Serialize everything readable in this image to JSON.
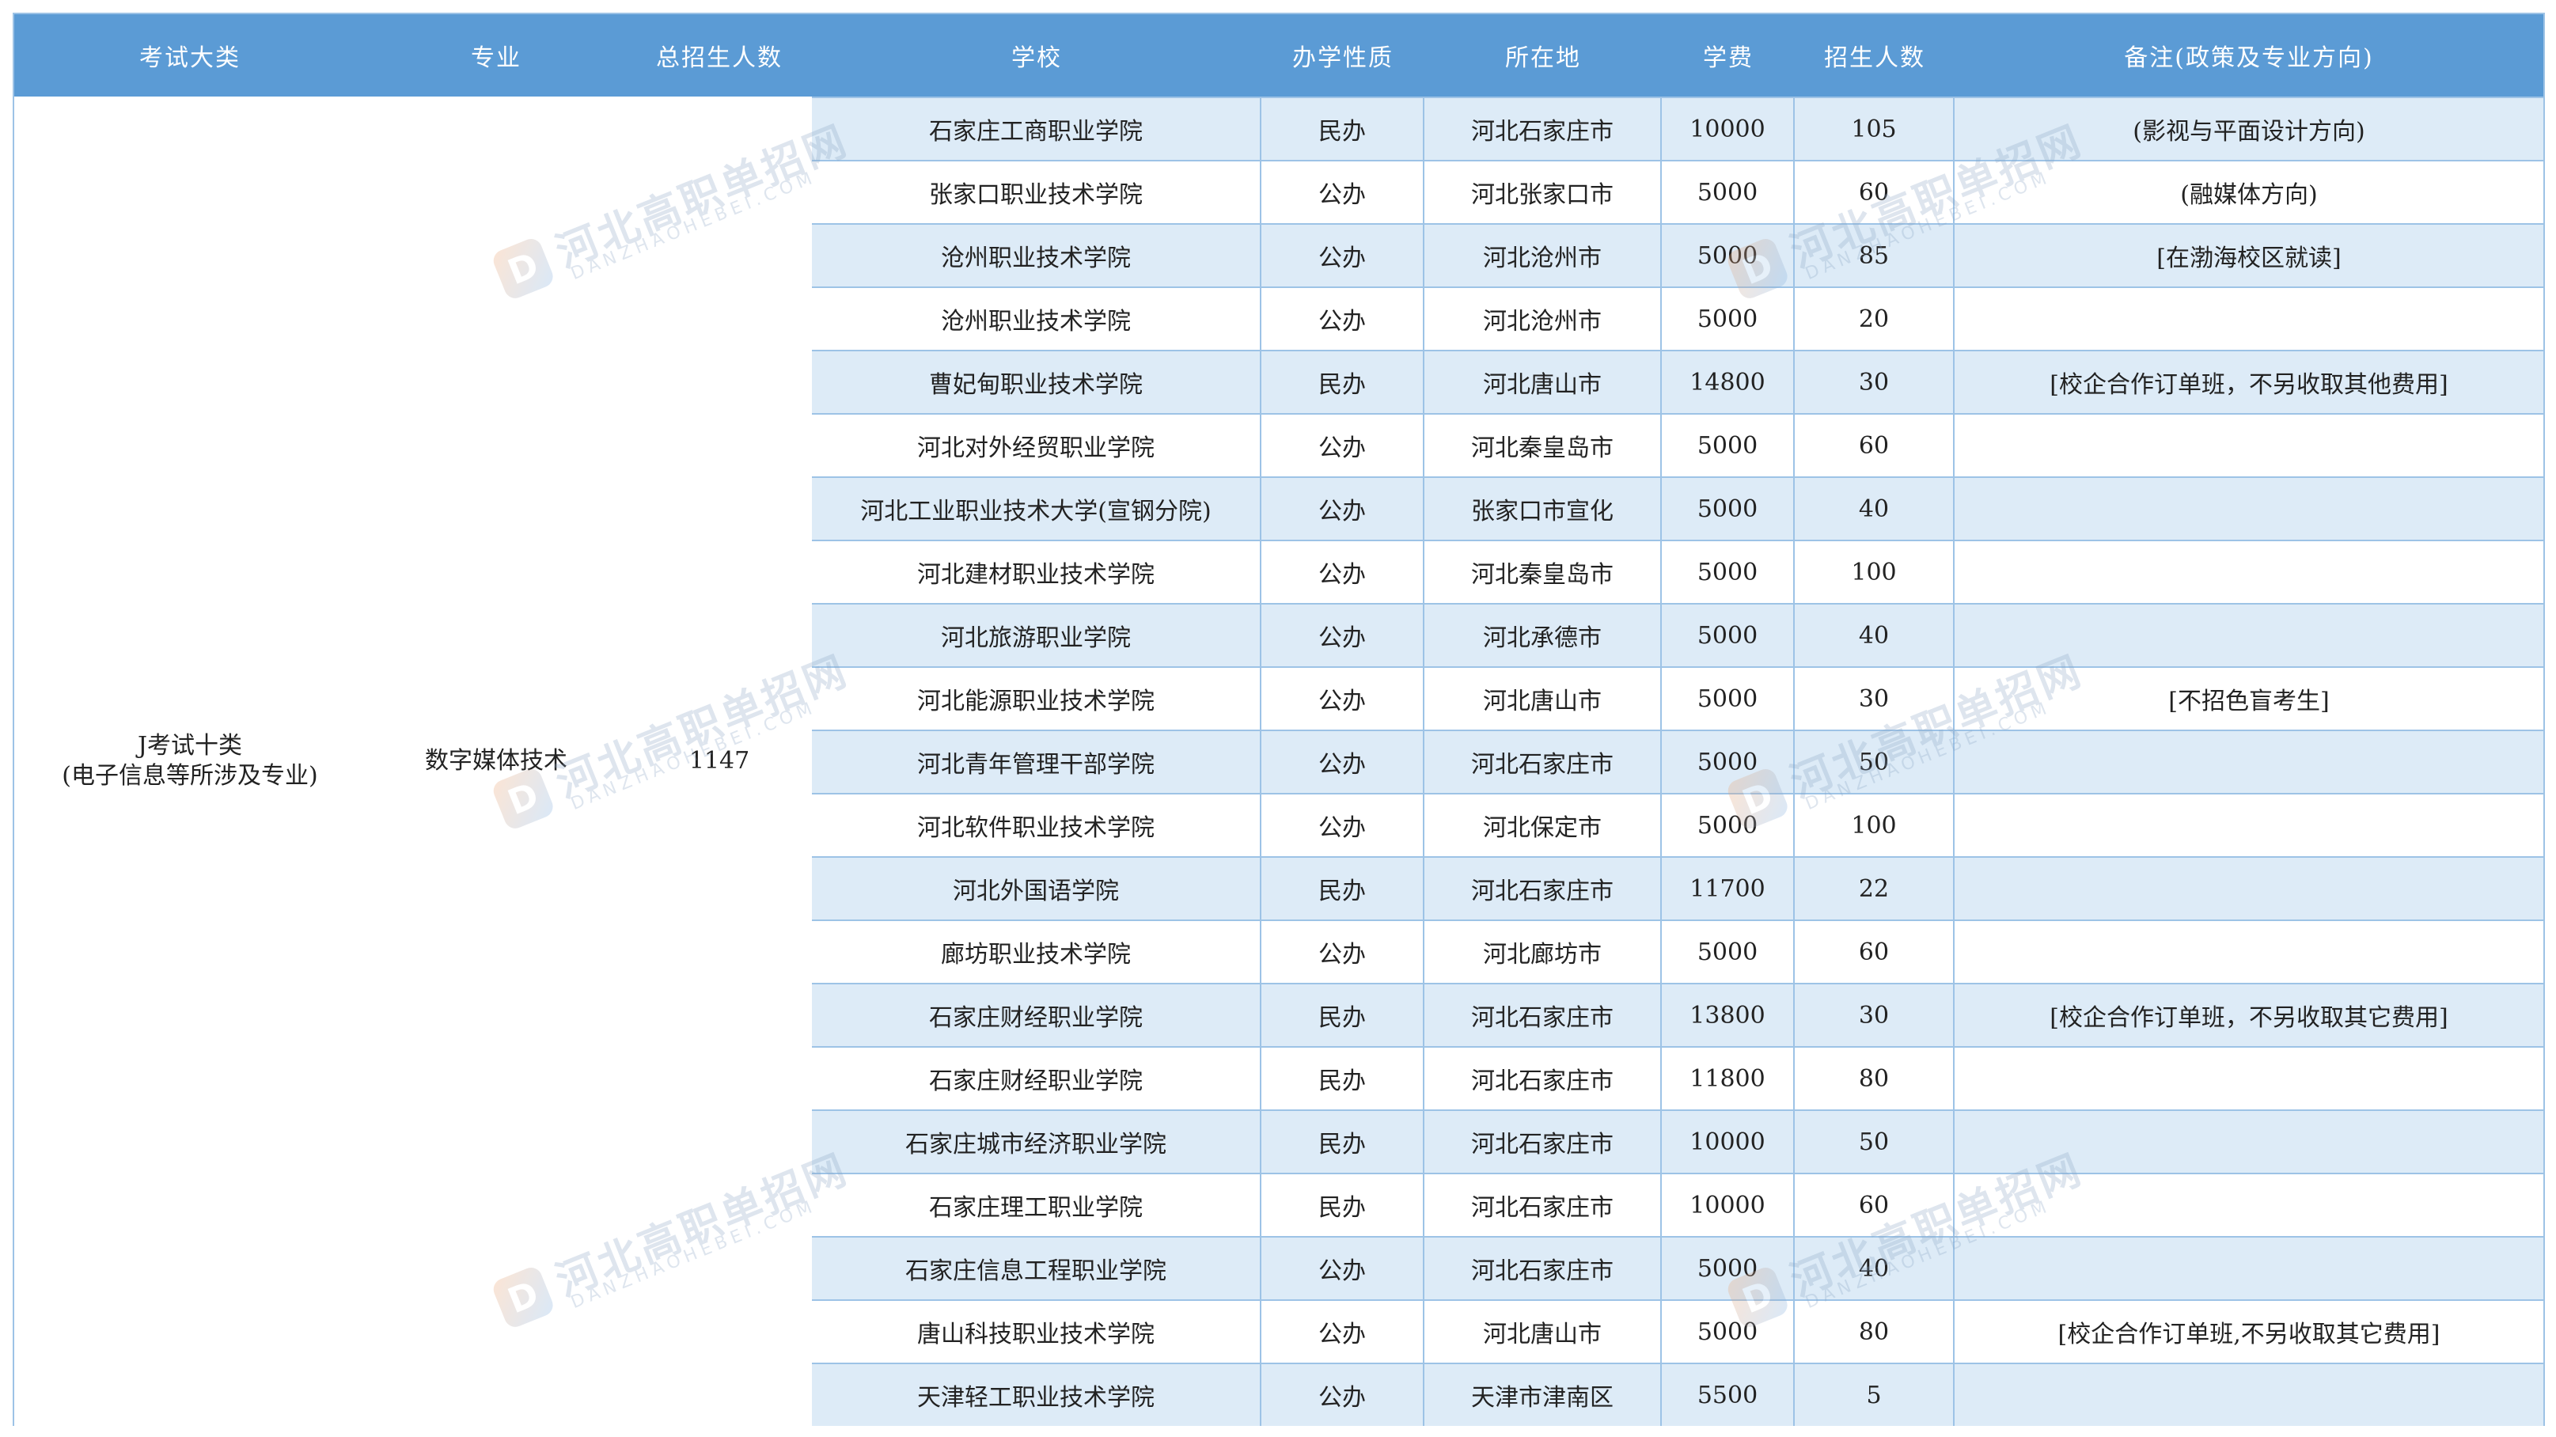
{
  "header": {
    "col1": "考试大类",
    "col2": "专业",
    "col3": "总招生人数",
    "col4": "学校",
    "col5": "办学性质",
    "col6": "所在地",
    "col7": "学费",
    "col8": "招生人数",
    "col9": "备注(政策及专业方向)"
  },
  "group": {
    "category_line1": "J考试十类",
    "category_line2": "(电子信息等所涉及专业)",
    "major": "数字媒体技术",
    "total": "1147"
  },
  "watermark": {
    "text_cn": "河北高职单招网",
    "text_en": "DANZHAOHEBEI.COM",
    "logo_letter": "D"
  },
  "rows": [
    {
      "school": "石家庄工商职业学院",
      "nature": "民办",
      "location": "河北石家庄市",
      "fee": "10000",
      "count": "105",
      "note": "(影视与平面设计方向)"
    },
    {
      "school": "张家口职业技术学院",
      "nature": "公办",
      "location": "河北张家口市",
      "fee": "5000",
      "count": "60",
      "note": "(融媒体方向)"
    },
    {
      "school": "沧州职业技术学院",
      "nature": "公办",
      "location": "河北沧州市",
      "fee": "5000",
      "count": "85",
      "note": "[在渤海校区就读]"
    },
    {
      "school": "沧州职业技术学院",
      "nature": "公办",
      "location": "河北沧州市",
      "fee": "5000",
      "count": "20",
      "note": ""
    },
    {
      "school": "曹妃甸职业技术学院",
      "nature": "民办",
      "location": "河北唐山市",
      "fee": "14800",
      "count": "30",
      "note": "[校企合作订单班，不另收取其他费用]"
    },
    {
      "school": "河北对外经贸职业学院",
      "nature": "公办",
      "location": "河北秦皇岛市",
      "fee": "5000",
      "count": "60",
      "note": ""
    },
    {
      "school": "河北工业职业技术大学(宣钢分院)",
      "nature": "公办",
      "location": "张家口市宣化",
      "fee": "5000",
      "count": "40",
      "note": ""
    },
    {
      "school": "河北建材职业技术学院",
      "nature": "公办",
      "location": "河北秦皇岛市",
      "fee": "5000",
      "count": "100",
      "note": ""
    },
    {
      "school": "河北旅游职业学院",
      "nature": "公办",
      "location": "河北承德市",
      "fee": "5000",
      "count": "40",
      "note": ""
    },
    {
      "school": "河北能源职业技术学院",
      "nature": "公办",
      "location": "河北唐山市",
      "fee": "5000",
      "count": "30",
      "note": "[不招色盲考生]"
    },
    {
      "school": "河北青年管理干部学院",
      "nature": "公办",
      "location": "河北石家庄市",
      "fee": "5000",
      "count": "50",
      "note": ""
    },
    {
      "school": "河北软件职业技术学院",
      "nature": "公办",
      "location": "河北保定市",
      "fee": "5000",
      "count": "100",
      "note": ""
    },
    {
      "school": "河北外国语学院",
      "nature": "民办",
      "location": "河北石家庄市",
      "fee": "11700",
      "count": "22",
      "note": ""
    },
    {
      "school": "廊坊职业技术学院",
      "nature": "公办",
      "location": "河北廊坊市",
      "fee": "5000",
      "count": "60",
      "note": ""
    },
    {
      "school": "石家庄财经职业学院",
      "nature": "民办",
      "location": "河北石家庄市",
      "fee": "13800",
      "count": "30",
      "note": "[校企合作订单班，不另收取其它费用]"
    },
    {
      "school": "石家庄财经职业学院",
      "nature": "民办",
      "location": "河北石家庄市",
      "fee": "11800",
      "count": "80",
      "note": ""
    },
    {
      "school": "石家庄城市经济职业学院",
      "nature": "民办",
      "location": "河北石家庄市",
      "fee": "10000",
      "count": "50",
      "note": ""
    },
    {
      "school": "石家庄理工职业学院",
      "nature": "民办",
      "location": "河北石家庄市",
      "fee": "10000",
      "count": "60",
      "note": ""
    },
    {
      "school": "石家庄信息工程职业学院",
      "nature": "公办",
      "location": "河北石家庄市",
      "fee": "5000",
      "count": "40",
      "note": ""
    },
    {
      "school": "唐山科技职业技术学院",
      "nature": "公办",
      "location": "河北唐山市",
      "fee": "5000",
      "count": "80",
      "note": "[校企合作订单班,不另收取其它费用]"
    },
    {
      "school": "天津轻工职业技术学院",
      "nature": "公办",
      "location": "天津市津南区",
      "fee": "5500",
      "count": "5",
      "note": ""
    }
  ]
}
